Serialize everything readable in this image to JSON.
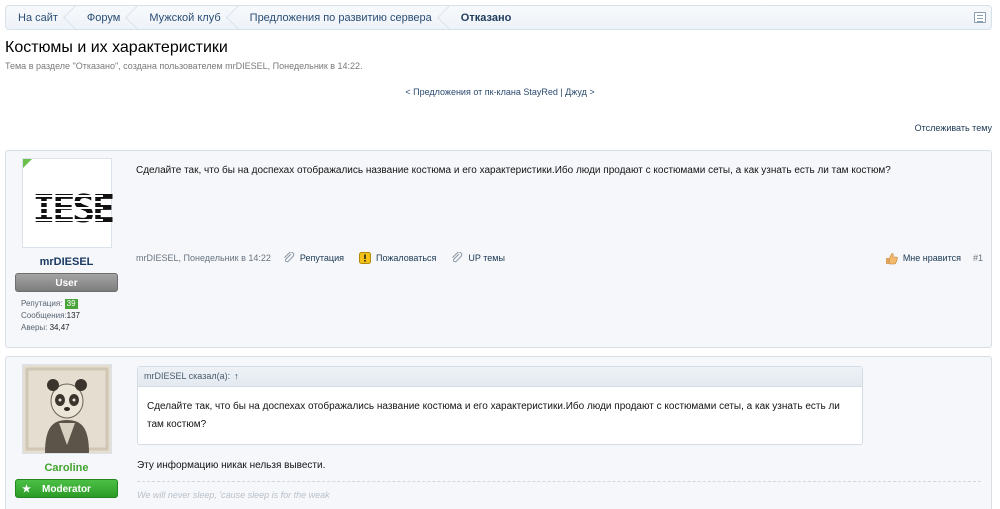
{
  "breadcrumb": {
    "items": [
      "На сайт",
      "Форум",
      "Мужской клуб",
      "Предложения по развитию сервера"
    ],
    "current": "Отказано"
  },
  "thread": {
    "title": "Костюмы и их характеристики",
    "subtitle": "Тема в разделе \"Отказано\", создана пользователем mrDIESEL, Понедельник в 14:22.",
    "nav": "< Предложения от пк-клана StayRed | Джуд >",
    "watch": "Отслеживать тему"
  },
  "posts": [
    {
      "author": "mrDIESEL",
      "avatar_text": "IESE",
      "role": "User",
      "stats": {
        "rep_label": "Репутация:",
        "rep_value": "39",
        "msgs_label": "Сообщения:",
        "msgs_value": "137",
        "av_label": "Аверы:",
        "av_value": "34,47"
      },
      "message": "Сделайте так, что бы на доспехах отображались название костюма и его характеристики.Ибо люди продают с костюмами сеты, а как узнать есть ли там костюм?",
      "meta_author": "mrDIESEL",
      "meta_date": ", Понедельник в 14:22",
      "actions": [
        "Репутация",
        "Пожаловаться",
        "UP темы"
      ],
      "like": "Мне нравится",
      "number": "#1"
    },
    {
      "author": "Caroline",
      "role": "Moderator",
      "quote_head": "mrDIESEL сказал(а):",
      "quote_up": "↑",
      "quote_text": "Сделайте так, что бы на доспехах отображались название костюма и его характеристики.Ибо люди продают с костюмами сеты, а как узнать есть ли там костюм?",
      "message": "Эту информацию никак нельзя вывести.",
      "signature": "We will never sleep, 'cause sleep is for the weak"
    }
  ],
  "colors": {
    "accent": "#1c3854",
    "user_green": "#42a42f",
    "badge_green": "#49a43a"
  }
}
